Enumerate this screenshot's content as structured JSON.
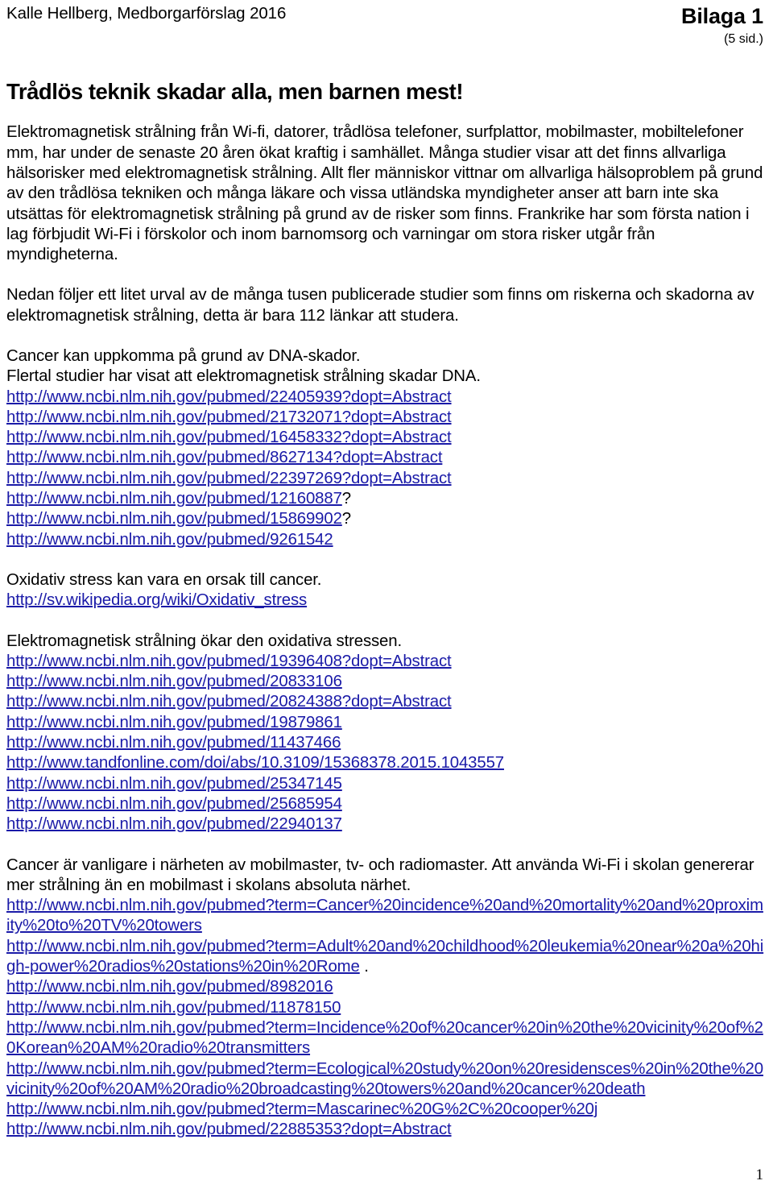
{
  "header": {
    "author_line": "Kalle Hellberg, Medborgarförslag 2016",
    "attachment_title": "Bilaga 1",
    "attachment_pages": "(5 sid.)"
  },
  "title": "Trådlös teknik skadar alla, men barnen mest!",
  "intro": {
    "paragraph1": "Elektromagnetisk strålning från Wi-fi, datorer, trådlösa telefoner, surfplattor, mobilmaster, mobiltelefoner mm, har under de senaste 20 åren ökat kraftig i samhället. Många studier visar att det finns allvarliga hälsorisker med elektromagnetisk strålning. Allt fler människor vittnar om allvarliga hälsoproblem på grund av den trådlösa tekniken och många läkare och vissa utländska myndigheter anser att barn inte ska utsättas för elektromagnetisk strålning på grund av de risker som finns. Frankrike har som första nation i lag förbjudit Wi-Fi i förskolor och inom barnomsorg och varningar om stora risker utgår från myndigheterna.",
    "paragraph2": "Nedan följer ett litet urval av de många tusen publicerade studier som finns om riskerna och skadorna av elektromagnetisk strålning, detta är bara 112 länkar att studera."
  },
  "sections": [
    {
      "id": "dna",
      "heading_lines": [
        "Cancer kan uppkomma på grund av DNA-skador.",
        "Flertal studier har visat att elektromagnetisk strålning skadar DNA."
      ],
      "links": [
        {
          "url": "http://www.ncbi.nlm.nih.gov/pubmed/22405939?dopt=Abstract",
          "trailing": ""
        },
        {
          "url": "http://www.ncbi.nlm.nih.gov/pubmed/21732071?dopt=Abstract",
          "trailing": ""
        },
        {
          "url": "http://www.ncbi.nlm.nih.gov/pubmed/16458332?dopt=Abstract",
          "trailing": ""
        },
        {
          "url": "http://www.ncbi.nlm.nih.gov/pubmed/8627134?dopt=Abstract",
          "trailing": ""
        },
        {
          "url": "http://www.ncbi.nlm.nih.gov/pubmed/22397269?dopt=Abstract",
          "trailing": ""
        },
        {
          "url": "http://www.ncbi.nlm.nih.gov/pubmed/12160887",
          "trailing": "?"
        },
        {
          "url": "http://www.ncbi.nlm.nih.gov/pubmed/15869902",
          "trailing": "?"
        },
        {
          "url": "http://www.ncbi.nlm.nih.gov/pubmed/9261542",
          "trailing": ""
        }
      ]
    },
    {
      "id": "oxidativ-stress-orsak",
      "heading_lines": [
        "Oxidativ stress kan vara en orsak till cancer."
      ],
      "links": [
        {
          "url": "http://sv.wikipedia.org/wiki/Oxidativ_stress",
          "trailing": ""
        }
      ]
    },
    {
      "id": "oxidativ-stress-okar",
      "heading_lines": [
        "Elektromagnetisk strålning ökar den oxidativa stressen."
      ],
      "links": [
        {
          "url": "http://www.ncbi.nlm.nih.gov/pubmed/19396408?dopt=Abstract",
          "trailing": ""
        },
        {
          "url": "http://www.ncbi.nlm.nih.gov/pubmed/20833106",
          "trailing": ""
        },
        {
          "url": "http://www.ncbi.nlm.nih.gov/pubmed/20824388?dopt=Abstract",
          "trailing": ""
        },
        {
          "url": "http://www.ncbi.nlm.nih.gov/pubmed/19879861",
          "trailing": ""
        },
        {
          "url": "http://www.ncbi.nlm.nih.gov/pubmed/11437466",
          "trailing": ""
        },
        {
          "url": "http://www.tandfonline.com/doi/abs/10.3109/15368378.2015.1043557",
          "trailing": ""
        },
        {
          "url": "http://www.ncbi.nlm.nih.gov/pubmed/25347145",
          "trailing": ""
        },
        {
          "url": "http://www.ncbi.nlm.nih.gov/pubmed/25685954",
          "trailing": ""
        },
        {
          "url": "http://www.ncbi.nlm.nih.gov/pubmed/22940137",
          "trailing": ""
        }
      ]
    },
    {
      "id": "mobilmaster",
      "heading_lines": [
        "Cancer är vanligare i närheten av mobilmaster, tv- och radiomaster. Att använda Wi-Fi i skolan genererar mer strålning än en mobilmast i skolans absoluta närhet."
      ],
      "links": [
        {
          "url": "http://www.ncbi.nlm.nih.gov/pubmed?term=Cancer%20incidence%20and%20mortality%20and%20proximity%20to%20TV%20towers",
          "trailing": ""
        },
        {
          "url": "http://www.ncbi.nlm.nih.gov/pubmed?term=Adult%20and%20childhood%20leukemia%20near%20a%20high-power%20radios%20stations%20in%20Rome",
          "trailing": " ."
        },
        {
          "url": "http://www.ncbi.nlm.nih.gov/pubmed/8982016",
          "trailing": ""
        },
        {
          "url": "http://www.ncbi.nlm.nih.gov/pubmed/11878150",
          "trailing": ""
        },
        {
          "url": "http://www.ncbi.nlm.nih.gov/pubmed?term=Incidence%20of%20cancer%20in%20the%20vicinity%20of%20Korean%20AM%20radio%20transmitters",
          "trailing": ""
        },
        {
          "url": "http://www.ncbi.nlm.nih.gov/pubmed?term=Ecological%20study%20on%20residensces%20in%20the%20vicinity%20of%20AM%20radio%20broadcasting%20towers%20and%20cancer%20death",
          "trailing": ""
        },
        {
          "url": "http://www.ncbi.nlm.nih.gov/pubmed?term=Mascarinec%20G%2C%20cooper%20j",
          "trailing": ""
        },
        {
          "url": "http://www.ncbi.nlm.nih.gov/pubmed/22885353?dopt=Abstract",
          "trailing": ""
        }
      ]
    }
  ],
  "footer": {
    "page_number": "1"
  },
  "colors": {
    "link": "#1a1aa8",
    "text": "#000000",
    "background": "#ffffff"
  }
}
